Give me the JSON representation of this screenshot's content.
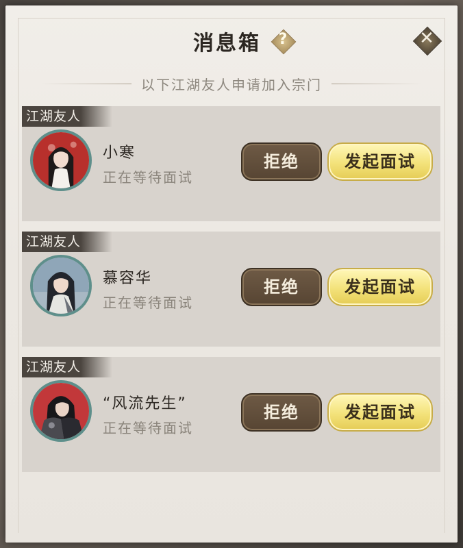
{
  "header": {
    "title": "消息箱",
    "help_glyph": "?",
    "close_glyph": "✕",
    "subtitle": "以下江湖友人申请加入宗门"
  },
  "applicants": [
    {
      "tag": "江湖友人",
      "name": "小寒",
      "status": "正在等待面试",
      "reject_label": "拒绝",
      "accept_label": "发起面试",
      "avatar": "female-portrait-red-background"
    },
    {
      "tag": "江湖友人",
      "name": "慕容华",
      "status": "正在等待面试",
      "reject_label": "拒绝",
      "accept_label": "发起面试",
      "avatar": "male-portrait-blue-background"
    },
    {
      "tag": "江湖友人",
      "name": "“风流先生”",
      "status": "正在等待面试",
      "reject_label": "拒绝",
      "accept_label": "发起面试",
      "avatar": "male-armored-portrait-red-background"
    }
  ]
}
